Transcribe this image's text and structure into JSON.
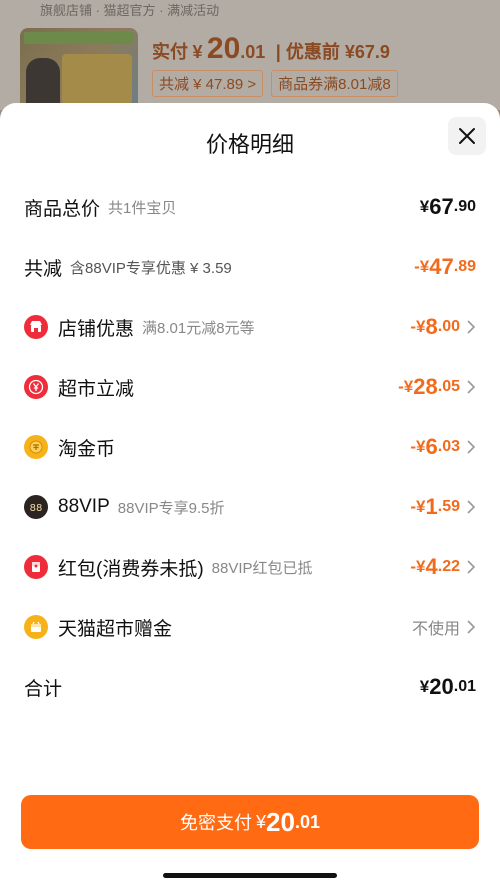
{
  "background": {
    "top_line": "ᅟ旗舰店铺 · 猫超官方 · 满减活动",
    "price_label": "实付",
    "price_currency": "¥",
    "price_int": "20",
    "price_dec": ".01",
    "orig_price": "| 优惠前 ¥67.9",
    "tag_total_reduce": "共减 ¥ 47.89 >",
    "tag_coupon": "商品券满8.01减8"
  },
  "sheet": {
    "title": "价格明细",
    "close_icon": "close-icon"
  },
  "rows": [
    {
      "label": "商品总价",
      "sub": "共1件宝贝",
      "currency": "¥",
      "int": "67",
      "dec": ".90",
      "orange": false,
      "chevron": false
    },
    {
      "label": "共减",
      "sub": "含88VIP专享优惠 ¥ 3.59",
      "currency": "-¥",
      "int": "47",
      "dec": ".89",
      "orange": true,
      "chevron": false
    },
    {
      "label": "店铺优惠",
      "sub": "满8.01元减8元等",
      "currency": "-¥",
      "int": "8",
      "dec": ".00",
      "orange": true,
      "chevron": true,
      "icon": "shop-icon",
      "icon_color": "#ef2c3a"
    },
    {
      "label": "超市立减",
      "sub": "",
      "currency": "-¥",
      "int": "28",
      "dec": ".05",
      "orange": true,
      "chevron": true,
      "icon": "yen-circle-icon",
      "icon_color": "#ef2c3a"
    },
    {
      "label": "淘金币",
      "sub": "",
      "currency": "-¥",
      "int": "6",
      "dec": ".03",
      "orange": true,
      "chevron": true,
      "icon": "gold-coin-icon",
      "icon_color": "#f7b21a"
    },
    {
      "label": "88VIP",
      "sub": "88VIP专享9.5折",
      "currency": "-¥",
      "int": "1",
      "dec": ".59",
      "orange": true,
      "chevron": true,
      "icon": "vip88-icon",
      "icon_color": "#2b2420"
    },
    {
      "label": "红包(消费券未抵)",
      "sub": "88VIP红包已抵",
      "currency": "-¥",
      "int": "4",
      "dec": ".22",
      "orange": true,
      "chevron": true,
      "icon": "red-packet-icon",
      "icon_color": "#ef2c3a"
    },
    {
      "label": "天猫超市赠金",
      "sub": "",
      "value_text": "不使用",
      "chevron": true,
      "icon": "gift-bonus-icon",
      "icon_color": "#f7b21a"
    },
    {
      "label": "合计",
      "sub": "",
      "currency": "¥",
      "int": "20",
      "dec": ".01",
      "orange": false,
      "chevron": false
    }
  ],
  "pay_button": {
    "label": "免密支付",
    "currency": "¥",
    "int": "20",
    "dec": ".01"
  },
  "colors": {
    "accent": "#ff6a12",
    "discount": "#f26b1d",
    "red_icon": "#ef2c3a",
    "gold_icon": "#f7b21a"
  }
}
